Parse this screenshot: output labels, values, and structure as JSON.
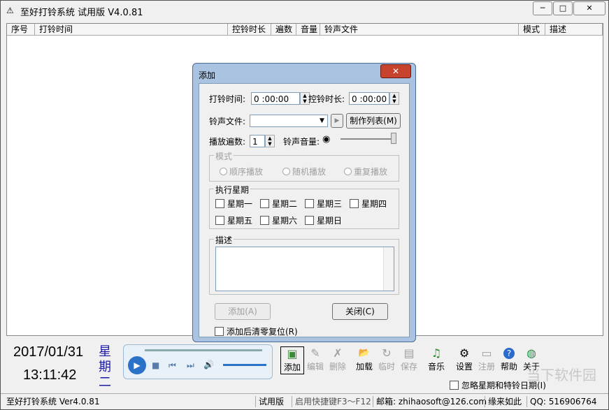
{
  "window": {
    "title": "至好打铃系统 试用版 V4.0.81",
    "minimize": "─",
    "maximize": "□",
    "close": "✕"
  },
  "columns": [
    "序号",
    "打铃时间",
    "控铃时长",
    "遍数",
    "音量",
    "铃声文件",
    "模式",
    "描述"
  ],
  "clock": {
    "date": "2017/01/31",
    "time": "13:11:42",
    "weekday": "星期二"
  },
  "toolbar": [
    {
      "label": "添加",
      "icon": "add-icon",
      "glyph": "▣"
    },
    {
      "label": "编辑",
      "icon": "edit-icon",
      "glyph": "✎"
    },
    {
      "label": "删除",
      "icon": "delete-icon",
      "glyph": "✗"
    },
    {
      "label": "加载",
      "icon": "folder-icon",
      "glyph": "📂"
    },
    {
      "label": "临时",
      "icon": "temp-icon",
      "glyph": "↻"
    },
    {
      "label": "保存",
      "icon": "save-icon",
      "glyph": "▤"
    },
    {
      "label": "音乐",
      "icon": "music-icon",
      "glyph": "♫"
    },
    {
      "label": "设置",
      "icon": "gear-icon",
      "glyph": "⚙"
    },
    {
      "label": "注册",
      "icon": "register-icon",
      "glyph": "▭"
    },
    {
      "label": "帮助",
      "icon": "help-icon",
      "glyph": "?"
    },
    {
      "label": "关于",
      "icon": "globe-icon",
      "glyph": "◍"
    }
  ],
  "ignore_holiday_label": "忽略星期和特铃日期(I)",
  "status": {
    "app": "至好打铃系统 Ver4.0.81",
    "edition": "试用版",
    "hotkey": "启用快捷键F3～F12",
    "email": "邮箱: zhihaosoft@126.com",
    "slogan": "缘来如此",
    "qq": "QQ: 516906764"
  },
  "dialog": {
    "title": "添加",
    "close": "✕",
    "ring_time_label": "打铃时间:",
    "ring_time_value": "0 :00:00",
    "duration_label": "控铃时长:",
    "duration_value": "0 :00:00",
    "file_label": "铃声文件:",
    "file_value": "",
    "playlist_button": "制作列表(M)",
    "play_count_label": "播放遍数:",
    "play_count_value": "1",
    "volume_label": "铃声音量:",
    "mode_title": "模式",
    "modes": [
      "顺序播放",
      "随机播放",
      "重复播放"
    ],
    "weekdays_title": "执行星期",
    "weekdays": [
      "星期一",
      "星期二",
      "星期三",
      "星期四",
      "星期五",
      "星期六",
      "星期日"
    ],
    "desc_title": "描述",
    "add_button": "添加(A)",
    "close_button": "关闭(C)",
    "reset_label": "添加后清零复位(R)"
  },
  "watermark": "当下软件园"
}
